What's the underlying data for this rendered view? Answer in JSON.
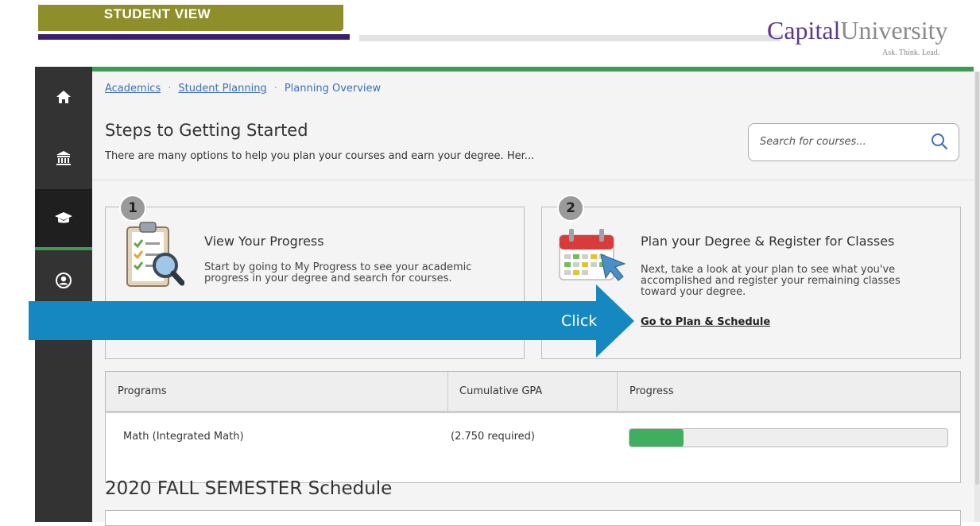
{
  "banner": {
    "student_view": "STUDENT VIEW",
    "university_name_a": "Capital",
    "university_name_b": "University",
    "tagline": "Ask. Think. Lead.",
    "colors": {
      "olive": "#8e8f2b",
      "purple": "#3b1f6e",
      "green": "#3e9b53",
      "blue": "#1588c1"
    }
  },
  "sidebar": {
    "items": [
      {
        "icon": "home-icon",
        "glyph": "⌂"
      },
      {
        "icon": "institution-icon",
        "glyph": "🏛"
      },
      {
        "icon": "graduation-cap-icon",
        "glyph": "🎓",
        "active": true
      },
      {
        "icon": "user-icon",
        "glyph": "👤"
      }
    ]
  },
  "breadcrumb": {
    "items": [
      "Academics",
      "Student Planning",
      "Planning Overview"
    ]
  },
  "header": {
    "title": "Steps to Getting Started",
    "subtitle": "There are many options to help you plan your courses and earn your degree. Her..."
  },
  "search": {
    "placeholder": "Search for courses..."
  },
  "steps": [
    {
      "number": "1",
      "title": "View Your Progress",
      "desc_line1": "Start by going to My Progress to see your academic",
      "desc_line2": "progress in your degree and search for courses."
    },
    {
      "number": "2",
      "title": "Plan your Degree & Register for Classes",
      "desc_line1": "Next, take a look at your plan to see what you've",
      "desc_line2": "accomplished and register your remaining classes",
      "desc_line3": "toward your degree.",
      "link": "Go to Plan & Schedule"
    }
  ],
  "annotation": {
    "arrow_label": "Click"
  },
  "programs": {
    "headers": [
      "Programs",
      "Cumulative GPA",
      "Progress"
    ],
    "rows": [
      {
        "program": "Math (Integrated Math)",
        "gpa": "(2.750 required)",
        "progress_fraction": 0.17
      }
    ]
  },
  "schedule": {
    "title": "2020 FALL SEMESTER Schedule"
  }
}
